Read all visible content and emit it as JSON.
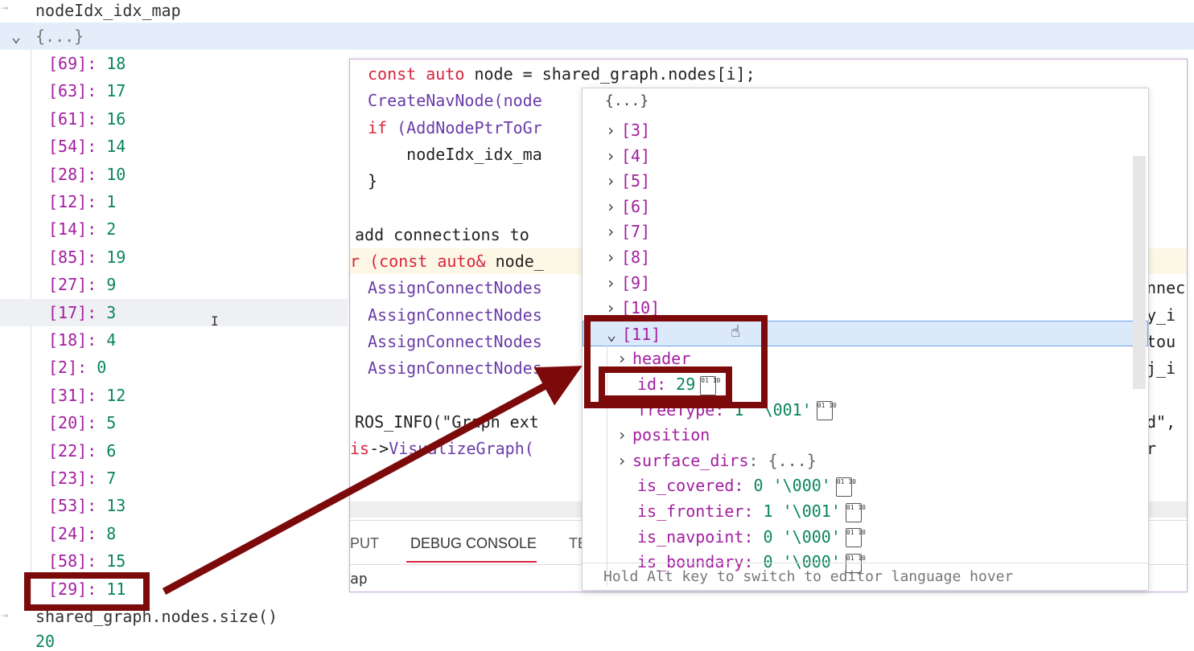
{
  "watch": {
    "expr1": "nodeIdx_idx_map",
    "obj": "{...}",
    "entries": [
      {
        "k": "[69]",
        "v": "18"
      },
      {
        "k": "[63]",
        "v": "17"
      },
      {
        "k": "[61]",
        "v": "16"
      },
      {
        "k": "[54]",
        "v": "14"
      },
      {
        "k": "[28]",
        "v": "10"
      },
      {
        "k": "[12]",
        "v": "1"
      },
      {
        "k": "[14]",
        "v": "2"
      },
      {
        "k": "[85]",
        "v": "19"
      },
      {
        "k": "[27]",
        "v": "9"
      },
      {
        "k": "[17]",
        "v": "3"
      },
      {
        "k": "[18]",
        "v": "4"
      },
      {
        "k": "[2]",
        "v": "0"
      },
      {
        "k": "[31]",
        "v": "12"
      },
      {
        "k": "[20]",
        "v": "5"
      },
      {
        "k": "[22]",
        "v": "6"
      },
      {
        "k": "[23]",
        "v": "7"
      },
      {
        "k": "[53]",
        "v": "13"
      },
      {
        "k": "[24]",
        "v": "8"
      },
      {
        "k": "[58]",
        "v": "15"
      },
      {
        "k": "[29]",
        "v": "11"
      }
    ],
    "expr2": "shared_graph.nodes.size()",
    "expr2_value": "20"
  },
  "editor": {
    "lines": [
      {
        "k1": "const auto ",
        "t1": "node = shared_graph.nodes[i];"
      },
      {
        "f1": "CreateNavNode(node"
      },
      {
        "k1": "if ",
        "f1": "(AddNodePtrToGr"
      },
      {
        "t1": "    nodeIdx_idx_ma"
      },
      {
        "t1": "}"
      },
      {
        "t1": ""
      },
      {
        "t1": "add connections to"
      },
      {
        "k1": "r (const auto& ",
        "t1": "node_"
      },
      {
        "f1": "AssignConnectNodes",
        "t2": "nnec"
      },
      {
        "f1": "AssignConnectNodes",
        "t2": "y_i"
      },
      {
        "f1": "AssignConnectNodes",
        "t2": "tou"
      },
      {
        "f1": "AssignConnectNodes",
        "t2": "j_i"
      },
      {
        "t1": ""
      },
      {
        "t1": "ROS_INFO(\"Graph ext",
        "t2": "d\","
      },
      {
        "k1": "is",
        "t1": "->",
        "f1": "VisualizeGraph(",
        "t2": "r"
      }
    ],
    "tabs": [
      "PUT",
      "DEBUG CONSOLE",
      "TE"
    ],
    "footer_text": "ap"
  },
  "hover": {
    "header": "{...}",
    "items": [
      "[3]",
      "[4]",
      "[5]",
      "[6]",
      "[7]",
      "[8]",
      "[9]",
      "[10]"
    ],
    "expanded": "[11]",
    "children": [
      {
        "kind": "node",
        "label": "header"
      },
      {
        "kind": "kv",
        "key": "id",
        "val": "29",
        "bin": true
      },
      {
        "kind": "kv",
        "key": "freeType",
        "val": "1 '\\001'",
        "bin": true
      },
      {
        "kind": "node",
        "label": "position"
      },
      {
        "kind": "node",
        "label": "surface_dirs",
        "tail": ": {...}"
      },
      {
        "kind": "kv",
        "key": "is_covered",
        "val": "0 '\\000'",
        "bin": true
      },
      {
        "kind": "kv",
        "key": "is_frontier",
        "val": "1 '\\001'",
        "bin": true
      },
      {
        "kind": "kv",
        "key": "is_navpoint",
        "val": "0 '\\000'",
        "bin": true
      },
      {
        "kind": "kv",
        "key": "is_boundary",
        "val": "0 '\\000'",
        "bin": true
      }
    ],
    "footer": "Hold Alt key to switch to editor language hover"
  },
  "annotation": {
    "color": "#7c0a0a"
  }
}
